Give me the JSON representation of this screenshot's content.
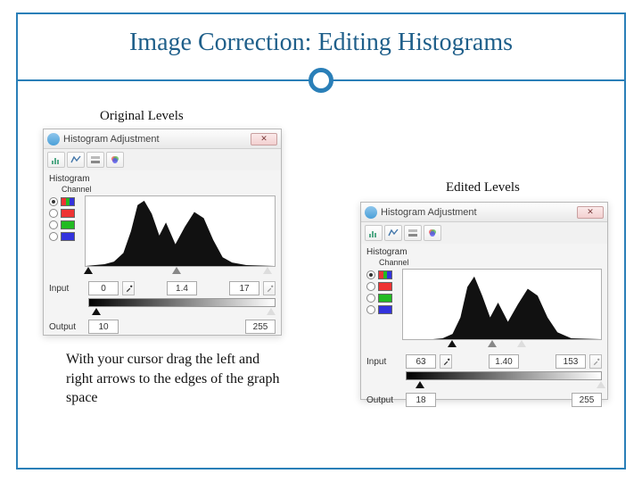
{
  "slide": {
    "title": "Image Correction: Editing Histograms",
    "label_original": "Original Levels",
    "label_edited": "Edited Levels",
    "caption": "With your cursor drag the left and right arrows to the edges of the graph space"
  },
  "dialog1": {
    "window_title": "Histogram Adjustment",
    "close_glyph": "✕",
    "section_histogram": "Histogram",
    "section_channel": "Channel",
    "row_input": "Input",
    "row_output": "Output",
    "input_black": "0",
    "input_gamma": "1.4",
    "input_white": "17",
    "output_black": "10",
    "output_white": "255",
    "slider_black_pct": 2,
    "slider_gray_pct": 48,
    "slider_white_pct": 96,
    "out_black_pct": 4,
    "out_white_pct": 98
  },
  "dialog2": {
    "window_title": "Histogram Adjustment",
    "close_glyph": "✕",
    "section_histogram": "Histogram",
    "section_channel": "Channel",
    "row_input": "Input",
    "row_output": "Output",
    "input_black": "63",
    "input_gamma": "1.40",
    "input_white": "153",
    "output_black": "18",
    "output_white": "255",
    "slider_black_pct": 25,
    "slider_gray_pct": 45,
    "slider_white_pct": 60,
    "out_black_pct": 7,
    "out_white_pct": 100
  }
}
